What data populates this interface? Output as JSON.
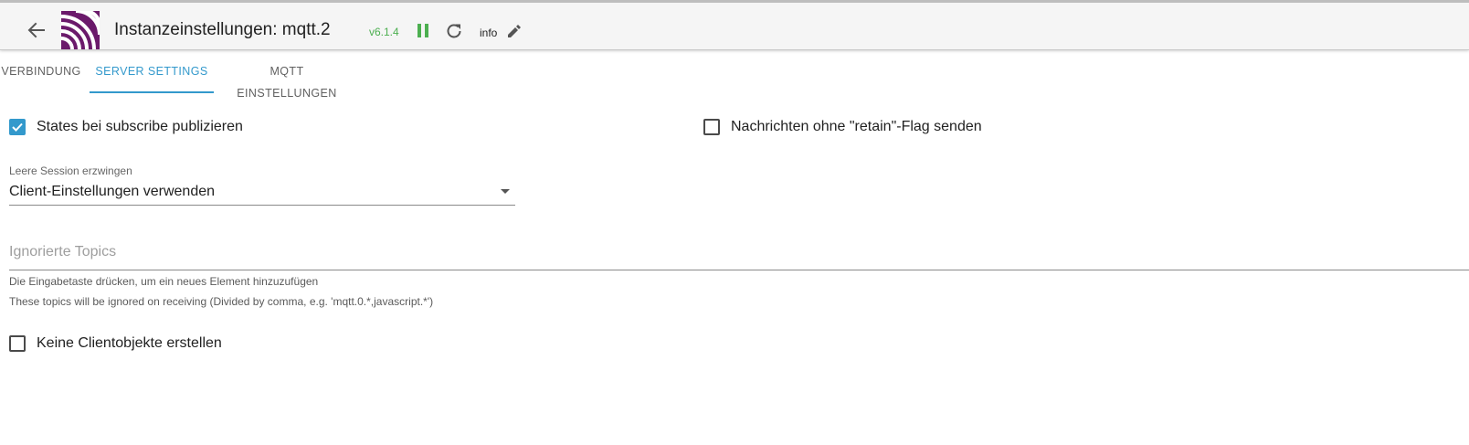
{
  "header": {
    "title": "Instanzeinstellungen: mqtt.2",
    "version": "v6.1.4",
    "loglevel": "info"
  },
  "colors": {
    "accent": "#3399cc",
    "version_green": "#4caf50",
    "logo_purple": "#6b1a6b"
  },
  "icons": {
    "back": "arrow-left-icon",
    "logo": "mqtt-logo-icon",
    "pause": "pause-icon",
    "reload": "reload-icon",
    "edit": "pencil-icon"
  },
  "tabs": [
    {
      "label": "Verbindung",
      "active": false
    },
    {
      "label": "Server settings",
      "active": true
    },
    {
      "label": "MQTT Einstellungen",
      "active": false
    }
  ],
  "settings": {
    "publish_states": {
      "label": "States bei subscribe publizieren",
      "checked": true
    },
    "no_retain": {
      "label": "Nachrichten ohne \"retain\"-Flag senden",
      "checked": false
    },
    "force_session": {
      "label": "Leere Session erzwingen",
      "value": "Client-Einstellungen verwenden"
    },
    "ignored_topics": {
      "placeholder": "Ignorierte Topics",
      "hint": "Die Eingabetaste drücken, um ein neues Element hinzuzufügen",
      "help": "These topics will be ignored on receiving (Divided by comma, e.g. 'mqtt.0.*,javascript.*')"
    },
    "no_client_objects": {
      "label": "Keine Clientobjekte erstellen",
      "checked": false
    }
  }
}
